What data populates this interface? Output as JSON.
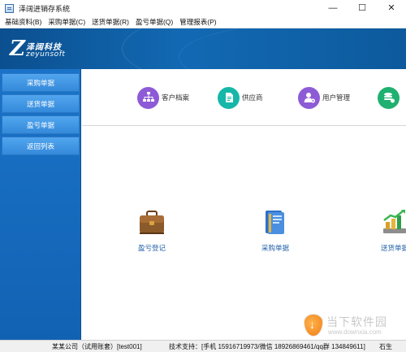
{
  "window": {
    "title": "泽阔进销存系统",
    "controls": {
      "minimize": "—",
      "maximize": "☐",
      "close": "✕"
    }
  },
  "menu": [
    "基础资料(B)",
    "采购单据(C)",
    "送货单据(R)",
    "盈亏单据(Q)",
    "管理报表(P)"
  ],
  "logo": {
    "letter": "Z",
    "cn": "泽阔科技",
    "en": "zeyunsoft"
  },
  "sidebar": {
    "items": [
      {
        "label": "采购单据"
      },
      {
        "label": "送货单据"
      },
      {
        "label": "盈亏单据"
      },
      {
        "label": "返回列表"
      }
    ]
  },
  "quick_links": [
    {
      "label": "客户档案",
      "icon": "org-chart-icon",
      "color": "#8e5bd6"
    },
    {
      "label": "供应商",
      "icon": "document-icon",
      "color": "#16b7a8"
    },
    {
      "label": "用户管理",
      "icon": "user-gear-icon",
      "color": "#8e5bd6"
    },
    {
      "label": "",
      "icon": "database-icon",
      "color": "#20b070"
    }
  ],
  "modules": [
    {
      "label": "盈亏登记",
      "icon": "briefcase-icon"
    },
    {
      "label": "采购单据",
      "icon": "folder-icon"
    },
    {
      "label": "送货单据",
      "icon": "growth-chart-icon"
    }
  ],
  "status": {
    "company": "某某公司（试用账套）[test001]",
    "support": "技术支持：[手机 15916719973/微信 18926869461/qq群 134849611]",
    "author": "石生"
  },
  "watermark": {
    "cn": "当下软件园",
    "en": "www.downxia.com"
  }
}
